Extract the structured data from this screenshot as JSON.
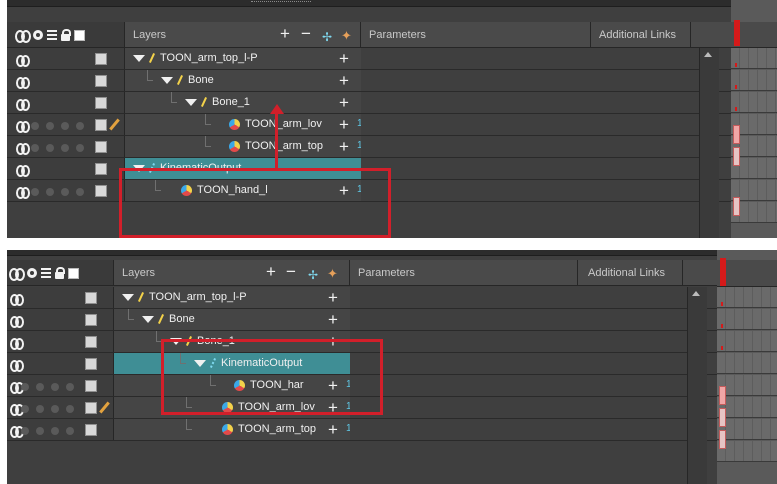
{
  "header": {
    "layers_label": "Layers",
    "parameters_label": "Parameters",
    "links_label": "Additional Links"
  },
  "icons": {
    "add": "plus-icon",
    "remove": "minus-icon",
    "add_peg": "add-peg-icon",
    "add_drawing": "add-drawing-icon"
  },
  "colors": {
    "selected_row": "#3f8e95",
    "highlight": "#d21f2a",
    "param_count": "#5fc7e5"
  },
  "before": {
    "rows": [
      {
        "name": "TOON_arm_top_l-P",
        "type": "peg",
        "expanded": true,
        "param": ""
      },
      {
        "name": "Bone",
        "type": "peg",
        "expanded": true,
        "param": ""
      },
      {
        "name": "Bone_1",
        "type": "peg",
        "expanded": true,
        "param": ""
      },
      {
        "name": "TOON_arm_lov",
        "type": "drawing",
        "param": "1"
      },
      {
        "name": "TOON_arm_top",
        "type": "drawing",
        "param": "1"
      },
      {
        "name": "KinematicOutput",
        "type": "kinematic",
        "expanded": true,
        "param": "",
        "selected": true
      },
      {
        "name": "TOON_hand_l",
        "type": "drawing",
        "param": "1"
      }
    ]
  },
  "after": {
    "rows": [
      {
        "name": "TOON_arm_top_l-P",
        "type": "peg",
        "expanded": true,
        "param": ""
      },
      {
        "name": "Bone",
        "type": "peg",
        "expanded": true,
        "param": ""
      },
      {
        "name": "Bone_1",
        "type": "peg",
        "expanded": true,
        "param": ""
      },
      {
        "name": "KinematicOutput",
        "type": "kinematic",
        "expanded": true,
        "param": "",
        "selected": true
      },
      {
        "name": "TOON_har",
        "type": "drawing",
        "param": "1"
      },
      {
        "name": "TOON_arm_lov",
        "type": "drawing",
        "param": "1"
      },
      {
        "name": "TOON_arm_top",
        "type": "drawing",
        "param": "1"
      }
    ]
  }
}
